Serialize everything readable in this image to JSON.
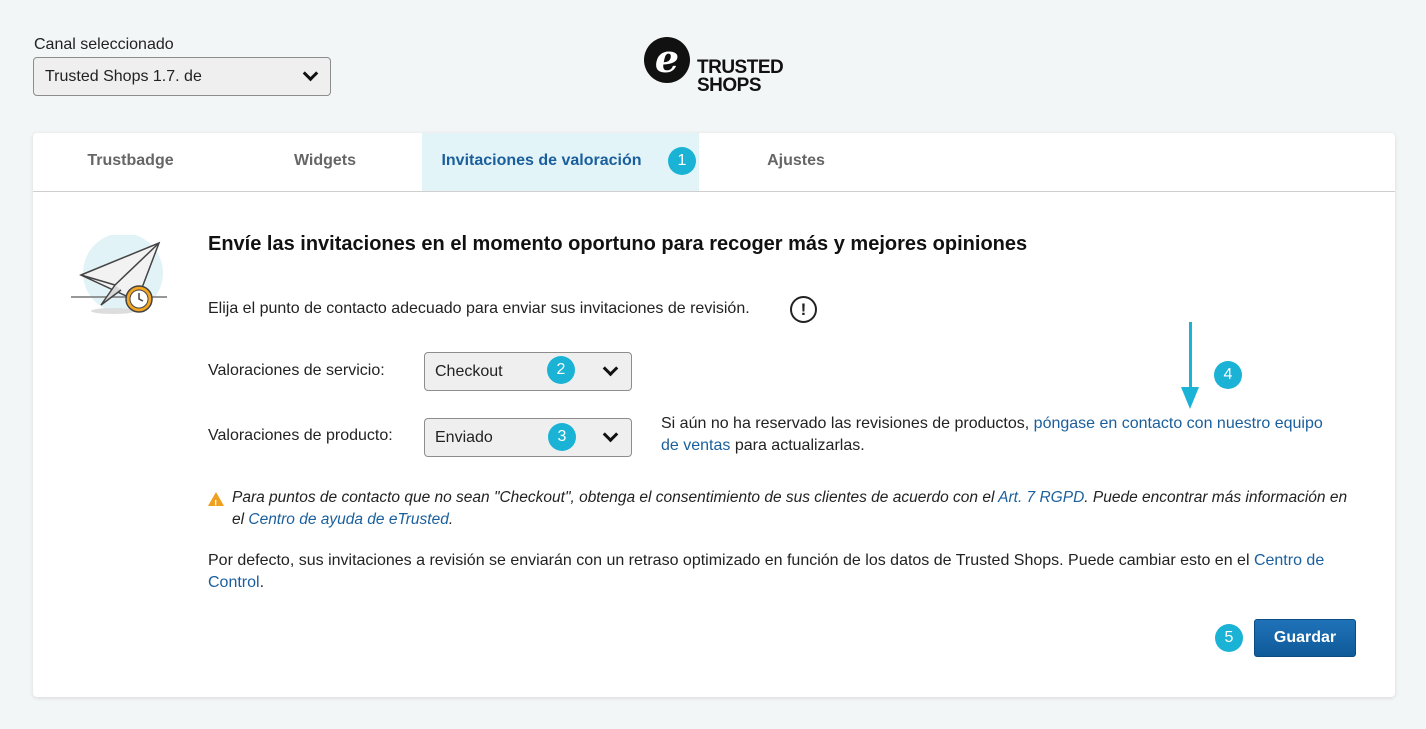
{
  "channel": {
    "label": "Canal seleccionado",
    "selected": "Trusted Shops 1.7. de"
  },
  "logo": {
    "brand_mark": "e",
    "line1": "TRUSTED",
    "line2": "SHOPS"
  },
  "tabs": [
    {
      "label": "Trustbadge"
    },
    {
      "label": "Widgets"
    },
    {
      "label": "Invitaciones de valoración"
    },
    {
      "label": "Ajustes"
    }
  ],
  "badges": {
    "b1": "1",
    "b2": "2",
    "b3": "3",
    "b4": "4",
    "b5": "5"
  },
  "main": {
    "heading": "Envíe las invitaciones en el momento oportuno para recoger más y mejores opiniones",
    "intro": "Elija el punto de contacto adecuado para enviar sus invitaciones de revisión.",
    "info_glyph": "!",
    "service_label": "Valoraciones de servicio:",
    "service_value": "Checkout",
    "product_label": "Valoraciones de producto:",
    "product_value": "Enviado",
    "note_pre": "Si aún no ha reservado las revisiones de productos, ",
    "note_link": "póngase en contacto con nuestro equipo de ventas",
    "note_post": " para actualizarlas.",
    "warning": {
      "part1": "Para puntos de contacto que no sean \"Checkout\", obtenga el consentimiento de sus clientes de acuerdo con el ",
      "link1": "Art. 7 RGPD",
      "part2": ". Puede encontrar más información en el ",
      "link2": "Centro de ayuda de eTrusted",
      "part3": "."
    },
    "default_text": "Por defecto, sus invitaciones a revisión se enviarán con un retraso optimizado en función de los datos de Trusted Shops. Puede cambiar esto en el ",
    "default_link": "Centro de Control",
    "default_end": ".",
    "save_label": "Guardar"
  },
  "colors": {
    "accent": "#1a5f9c",
    "badge": "#1ab3d6",
    "active_tab_bg": "#e3f4f8",
    "warning": "#f0a020"
  }
}
